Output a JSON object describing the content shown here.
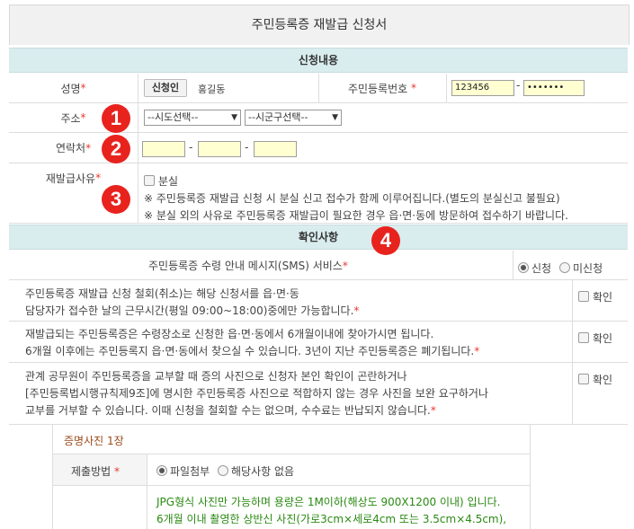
{
  "form_title": "주민등록증 재발급 신청서",
  "sections": {
    "application": "신청내용",
    "confirm": "확인사항"
  },
  "name_row": {
    "label": "성명",
    "applicant_button": "신청인",
    "name_value": "홍길동",
    "rrn_label": "주민등록번호",
    "rrn_front": "123456",
    "rrn_dash": "-",
    "rrn_back": "•••••••"
  },
  "address_row": {
    "label": "주소",
    "sido_select": "--시도선택--",
    "sigungu_select": "--시군구선택--"
  },
  "contact_row": {
    "label": "연락처",
    "dash": "-"
  },
  "reason_row": {
    "label": "재발급사유",
    "lost_option": "분실",
    "note1": "※ 주민등록증 재발급 신청 시 분실 신고 접수가 함께 이루어집니다.(별도의 분실신고 불필요)",
    "note2": "※ 분실 외의 사유로 주민등록증 재발급이 필요한 경우 읍·면·동에 방문하여 접수하기 바랍니다."
  },
  "sms_row": {
    "label": "주민등록증 수령 안내 메시지(SMS) 서비스",
    "opt_apply": "신청",
    "opt_not": "미신청"
  },
  "confirm_rows": [
    {
      "line1": "주민등록증 재발급 신청 철회(취소)는 해당 신청서를 읍·면·동",
      "line2": "담당자가 접수한 날의 근무시간(평일 09:00~18:00)중에만 가능합니다.",
      "check": "확인"
    },
    {
      "line1": "재발급되는 주민등록증은 수령장소로 신청한 읍·면·동에서 6개월이내에 찾아가시면 됩니다.",
      "line2": "6개월 이후에는 주민등록지 읍·면·동에서 찾으실 수 있습니다. 3년이 지난 주민등록증은 폐기됩니다.",
      "check": "확인"
    },
    {
      "line1": "관계 공무원이 주민등록증을 교부할 때 증의 사진으로 신청자 본인 확인이 곤란하거나",
      "line2": "[주민등록법시행규칙제9조]에 명시한 주민등록증 사진으로 적합하지 않는 경우 사진을 보완 요구하거나",
      "line3": "교부를 거부할 수 있습니다. 이때 신청을 철회할 수는 없으며, 수수료는 반납되지 않습니다.",
      "check": "확인"
    }
  ],
  "photo": {
    "title": "증명사진 1장",
    "method_label": "제출방법",
    "opt_file": "파일첨부",
    "opt_none": "해당사항 없음",
    "info1": "JPG형식 사진만 가능하며 용량은 1M이하(해상도 900X1200 이내) 입니다.",
    "info2": "6개월 이내 촬영한 상반신 사진(가로3cm×세로4cm 또는 3.5cm×4.5cm),"
  },
  "badges": [
    "1",
    "2",
    "3",
    "4"
  ],
  "colors": {
    "required": "#e8392c",
    "section_bg": "#d9ecee",
    "input_bg": "#ffffd2",
    "badge": "#e8231e",
    "info_text": "#2a8a12"
  }
}
